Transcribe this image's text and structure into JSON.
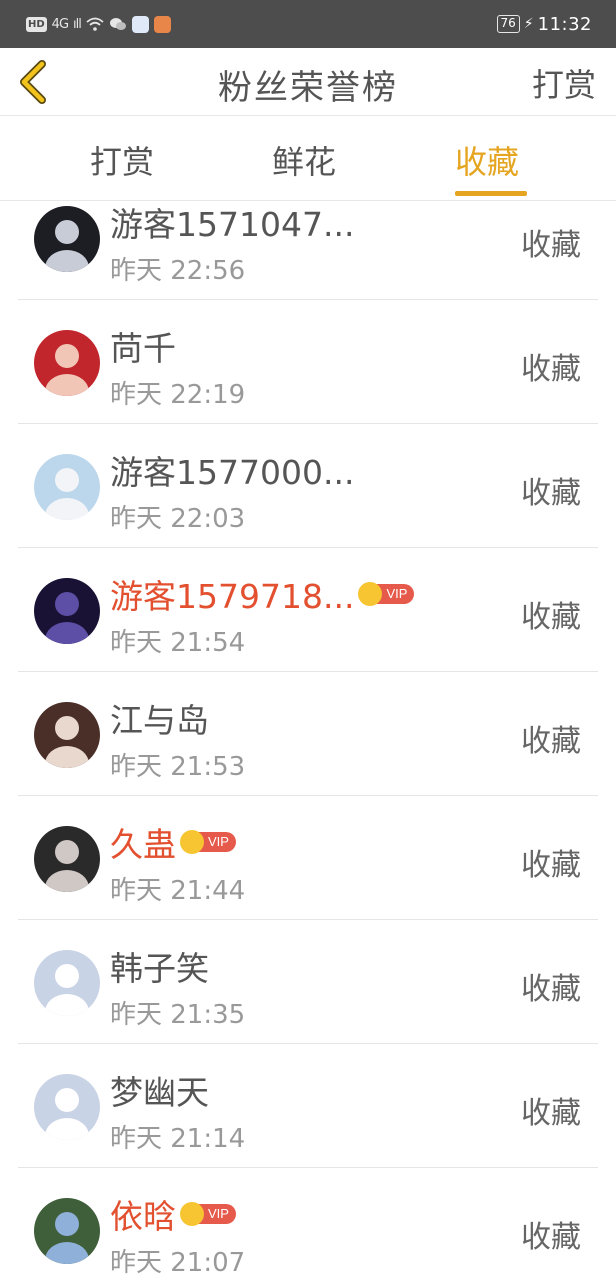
{
  "status_bar": {
    "hd": "HD",
    "network": "4G",
    "signal": "ıll",
    "battery": "76",
    "time": "11:32",
    "icons": [
      "wifi-icon",
      "wechat-icon",
      "app-icon",
      "video-app-icon",
      "charging-icon"
    ]
  },
  "header": {
    "back_icon": "chevron-left-icon",
    "title": "粉丝荣誉榜",
    "action": "打赏"
  },
  "tabs": [
    {
      "label": "打赏",
      "active": false
    },
    {
      "label": "鲜花",
      "active": false
    },
    {
      "label": "收藏",
      "active": true
    }
  ],
  "colors": {
    "accent": "#e5a521",
    "vip_name": "#e2502f",
    "vip_tag": "#e55a4b",
    "crown": "#f7c531",
    "status_bar": "#4d4d4d"
  },
  "rows": [
    {
      "name": "游客1571047...",
      "time": "昨天 22:56",
      "action": "收藏",
      "vip": false,
      "vip_label": "",
      "avatar_colors": [
        "#1d1d24",
        "#c7ccd6"
      ]
    },
    {
      "name": "苘千",
      "time": "昨天 22:19",
      "action": "收藏",
      "vip": false,
      "vip_label": "",
      "avatar_colors": [
        "#c2262d",
        "#f1c6b6"
      ]
    },
    {
      "name": "游客1577000...",
      "time": "昨天 22:03",
      "action": "收藏",
      "vip": false,
      "vip_label": "",
      "avatar_colors": [
        "#bcd7ec",
        "#f2f4f8"
      ]
    },
    {
      "name": "游客1579718...",
      "time": "昨天 21:54",
      "action": "收藏",
      "vip": true,
      "vip_label": "VIP",
      "avatar_colors": [
        "#1a1235",
        "#5d4fa5"
      ]
    },
    {
      "name": "江与岛",
      "time": "昨天 21:53",
      "action": "收藏",
      "vip": false,
      "vip_label": "",
      "avatar_colors": [
        "#4a2f28",
        "#e9d8cd"
      ]
    },
    {
      "name": "久蛊",
      "time": "昨天 21:44",
      "action": "收藏",
      "vip": true,
      "vip_label": "VIP",
      "avatar_colors": [
        "#2b2a2a",
        "#cfc8c4"
      ]
    },
    {
      "name": "韩子笑",
      "time": "昨天 21:35",
      "action": "收藏",
      "vip": false,
      "vip_label": "",
      "avatar_colors": [
        "#c9d3e6",
        "#ffffff"
      ]
    },
    {
      "name": "梦幽天",
      "time": "昨天 21:14",
      "action": "收藏",
      "vip": false,
      "vip_label": "",
      "avatar_colors": [
        "#c9d3e6",
        "#ffffff"
      ]
    },
    {
      "name": "依晗",
      "time": "昨天 21:07",
      "action": "收藏",
      "vip": true,
      "vip_label": "VIP",
      "avatar_colors": [
        "#3f5e3a",
        "#8fb0d8"
      ]
    }
  ]
}
